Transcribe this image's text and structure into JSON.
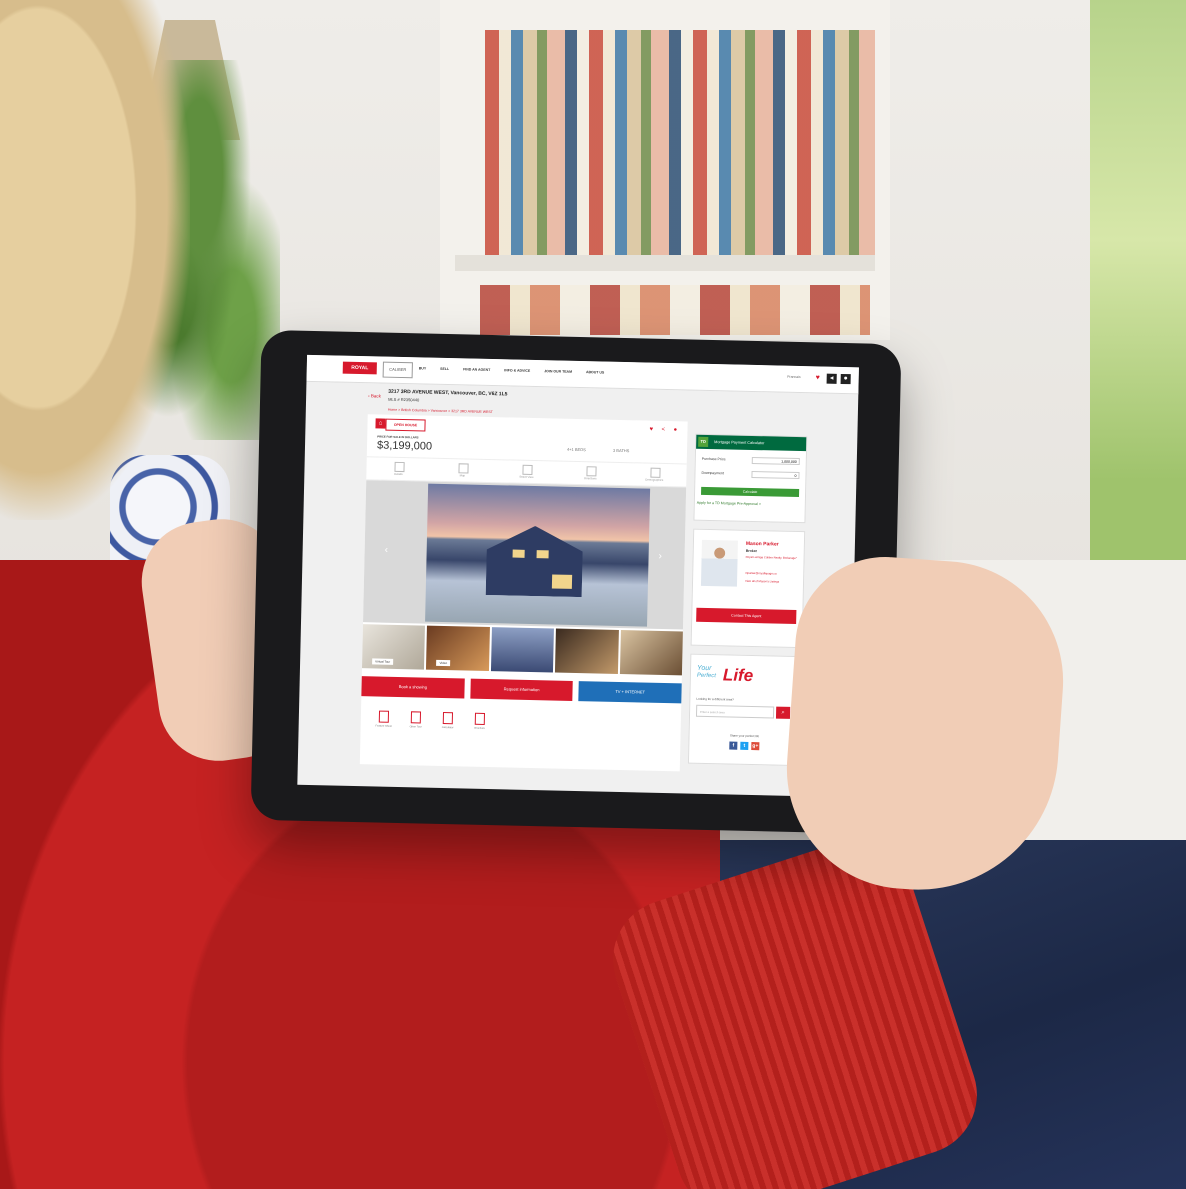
{
  "site": {
    "logo": "ROYAL LEPAGE",
    "partner_logo": "CALIBER",
    "nav_items": [
      "BUY",
      "SELL",
      "FIND AN AGENT",
      "INFO & ADVICE",
      "JOIN OUR TEAM",
      "ABOUT US"
    ],
    "search_label": "Francais",
    "nav_icons": [
      "heart-icon",
      "share-icon",
      "user-icon"
    ]
  },
  "listing": {
    "address": "3217 3RD AVENUE WEST, Vancouver, BC, V6Z 1L5",
    "mls": "MLS # R2350440",
    "back_label": "Back",
    "breadcrumb": "Home > British Columbia > Vancouver > 3217 3RD AVENUE WEST",
    "open_house": "OPEN HOUSE",
    "price_label": "PRICE FOR SALE IN DOLLARS",
    "price": "$3,199,000",
    "beds": "4+1 BEDS",
    "baths": "3 BATHS",
    "tabs": [
      "Details",
      "Map",
      "Street View",
      "Directions",
      "Demographics"
    ],
    "thumb_labels": [
      "Virtual Tour",
      "Video"
    ],
    "buttons": [
      "Book a showing",
      "Request information",
      "TV + INTERNET"
    ],
    "tools": [
      "Feature Sheet",
      "Open Tour",
      "Calculator",
      "Brochure"
    ],
    "colors": {
      "brand_red": "#d7192c",
      "blue": "#1f6fb8",
      "td_green": "#006a3f"
    }
  },
  "mortgage": {
    "title": "Mortgage Payment Calculator",
    "bank_logo": "TD",
    "purchase_label": "Purchase Price",
    "purchase_value": "1,000,000",
    "down_label": "Downpayment",
    "down_value": "0",
    "calc_label": "Calculate",
    "apply_label": "Apply for a TD Mortgage Pre-Approval >"
  },
  "agent": {
    "name": "Mason Parker",
    "title": "Broker",
    "company": "Royal LePage Caliber Realty, Brokerage*",
    "email": "mparker@royallepage.ca",
    "listings_link": "View all of Mason's Listings",
    "contact_label": "Contact This Agent"
  },
  "promo": {
    "your": "Your",
    "perfect": "Perfect",
    "life": "Life",
    "question": "Looking for a different area?",
    "placeholder": "Enter a search area",
    "share_label": "Share your perfect life",
    "social": [
      "f",
      "t",
      "g+"
    ]
  }
}
